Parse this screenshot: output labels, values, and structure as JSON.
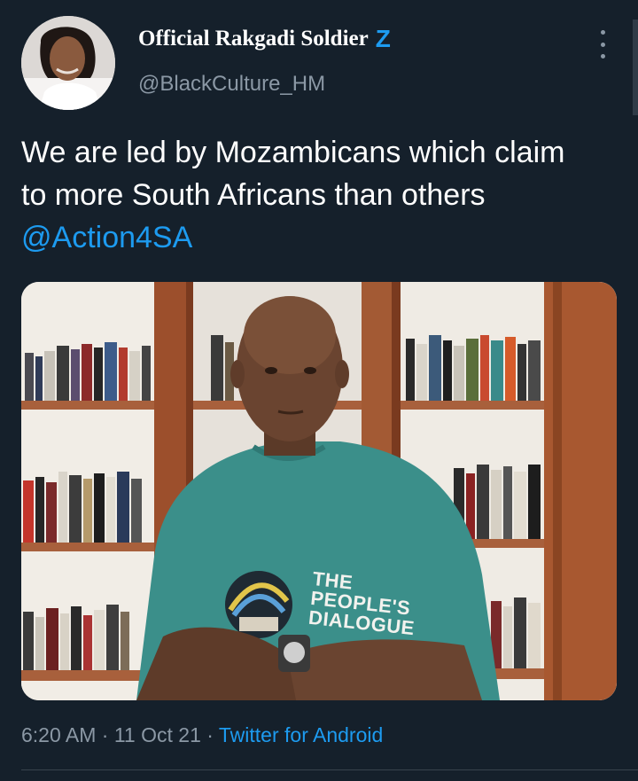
{
  "author": {
    "display_name": "Official Rakgadi Soldier",
    "verified_mark": "Z",
    "handle": "@BlackCulture_HM",
    "avatar_icon": "profile-photo"
  },
  "tweet": {
    "text_line1": "We are led by Mozambicans which claim",
    "text_line2": "to more South Africans than others",
    "mention": "@Action4SA"
  },
  "media": {
    "type": "photo",
    "shirt_text_line1": "THE",
    "shirt_text_line2": "PEOPLE'S",
    "shirt_text_line3": "DIALOGUE"
  },
  "meta": {
    "time": "6:20 AM",
    "separator1": " · ",
    "date": "11 Oct 21",
    "separator2": " · ",
    "source": "Twitter for Android"
  },
  "colors": {
    "background": "#15202b",
    "accent": "#1d9bf0",
    "secondary_text": "#8b98a5"
  }
}
